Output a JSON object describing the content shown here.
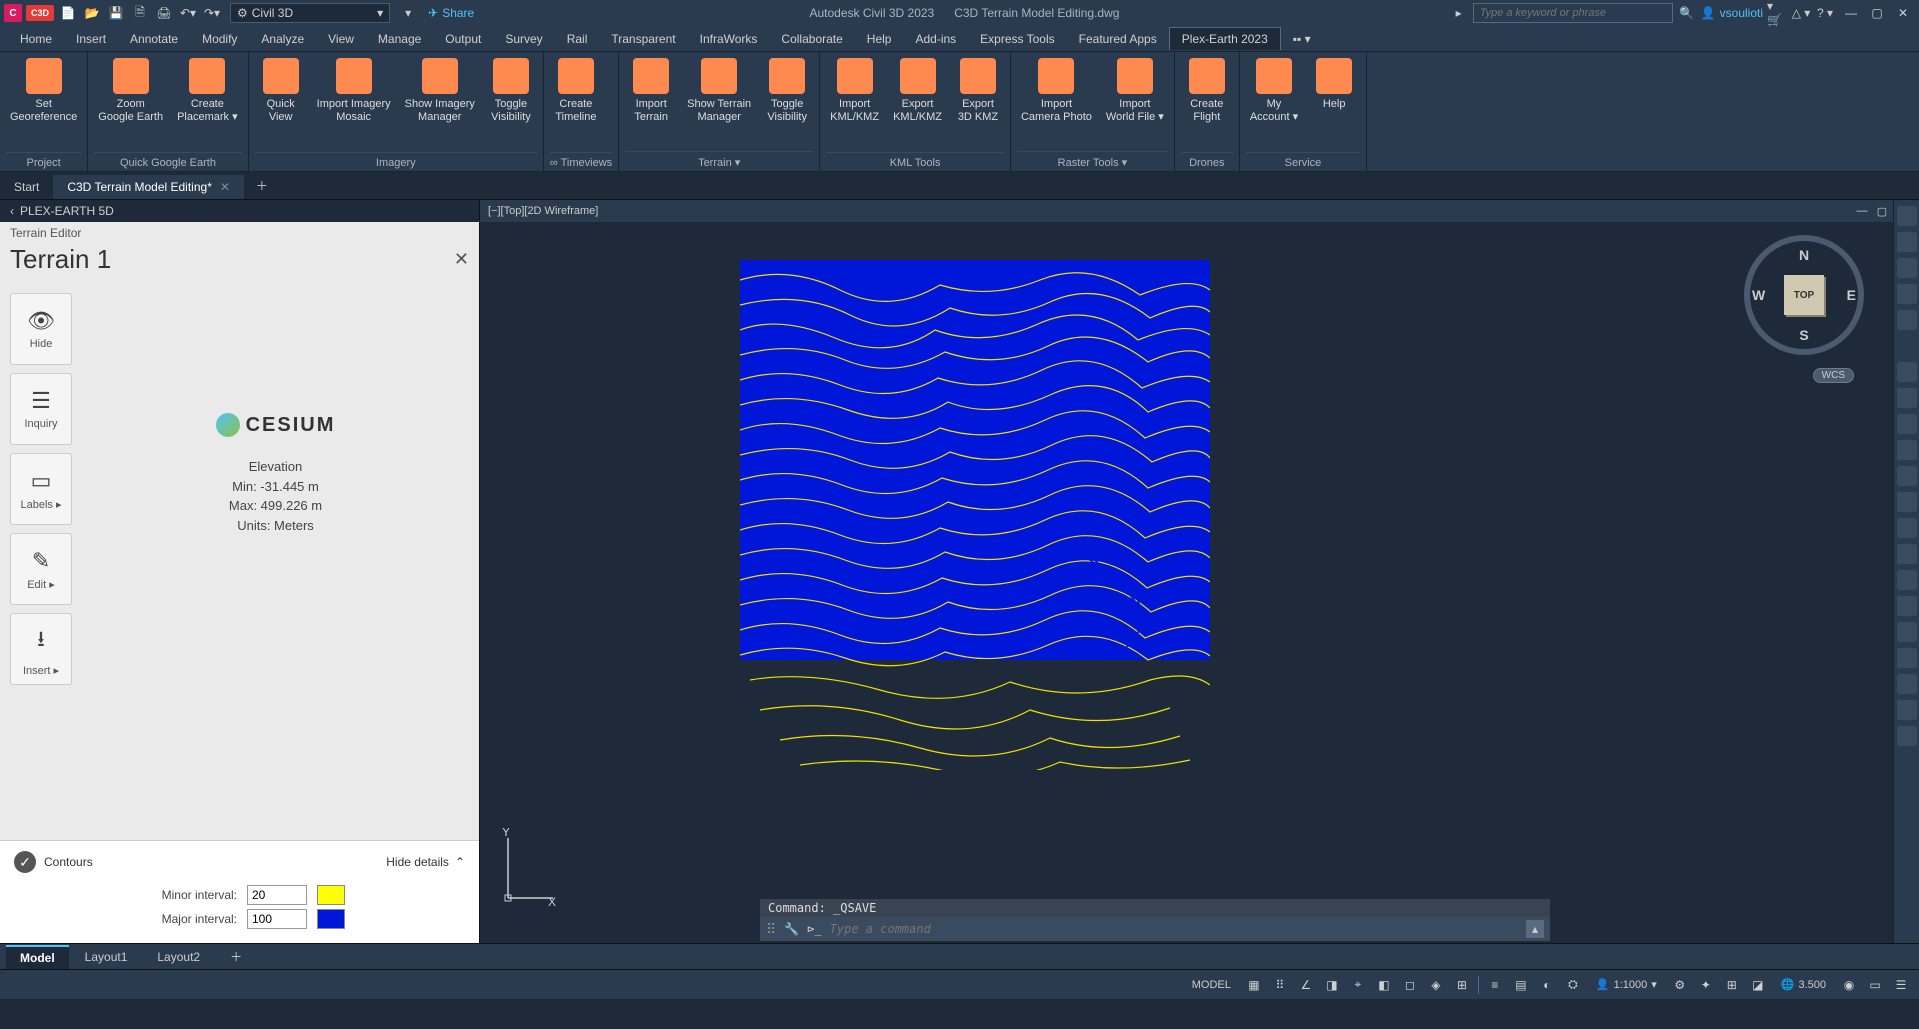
{
  "title": {
    "app": "Autodesk Civil 3D 2023",
    "file": "C3D Terrain Model Editing.dwg"
  },
  "qat": {
    "workspace": "Civil 3D",
    "share": "Share"
  },
  "search": {
    "placeholder": "Type a keyword or phrase"
  },
  "user": {
    "name": "vsoulioti"
  },
  "menu": [
    "Home",
    "Insert",
    "Annotate",
    "Modify",
    "Analyze",
    "View",
    "Manage",
    "Output",
    "Survey",
    "Rail",
    "Transparent",
    "InfraWorks",
    "Collaborate",
    "Help",
    "Add-ins",
    "Express Tools",
    "Featured Apps",
    "Plex-Earth 2023"
  ],
  "menu_active": 17,
  "ribbon": [
    {
      "title": "Project",
      "buttons": [
        {
          "label": "Set\nGeoreference"
        }
      ]
    },
    {
      "title": "Quick Google Earth",
      "buttons": [
        {
          "label": "Zoom\nGoogle Earth"
        },
        {
          "label": "Create\nPlacemark",
          "dd": true
        }
      ]
    },
    {
      "title": "Imagery",
      "buttons": [
        {
          "label": "Quick\nView"
        },
        {
          "label": "Import Imagery\nMosaic"
        },
        {
          "label": "Show Imagery\nManager"
        },
        {
          "label": "Toggle\nVisibility"
        }
      ]
    },
    {
      "title": "∞ Timeviews",
      "buttons": [
        {
          "label": "Create\nTimeline"
        }
      ]
    },
    {
      "title": "Terrain",
      "dd": true,
      "buttons": [
        {
          "label": "Import\nTerrain"
        },
        {
          "label": "Show Terrain\nManager"
        },
        {
          "label": "Toggle\nVisibility"
        }
      ]
    },
    {
      "title": "KML Tools",
      "buttons": [
        {
          "label": "Import\nKML/KMZ"
        },
        {
          "label": "Export\nKML/KMZ"
        },
        {
          "label": "Export\n3D KMZ"
        }
      ]
    },
    {
      "title": "Raster Tools",
      "dd": true,
      "buttons": [
        {
          "label": "Import\nCamera Photo"
        },
        {
          "label": "Import\nWorld File",
          "dd": true
        }
      ]
    },
    {
      "title": "Drones",
      "buttons": [
        {
          "label": "Create\nFlight"
        }
      ]
    },
    {
      "title": "Service",
      "buttons": [
        {
          "label": "My\nAccount",
          "dd": true
        },
        {
          "label": "Help"
        }
      ]
    }
  ],
  "docTabs": [
    {
      "label": "Start",
      "closable": false
    },
    {
      "label": "C3D Terrain Model Editing*",
      "closable": true,
      "active": true
    }
  ],
  "sidebar": {
    "header": "PLEX-EARTH 5D"
  },
  "terrainEditor": {
    "title": "Terrain Editor",
    "name": "Terrain 1",
    "tools": [
      {
        "label": "Hide",
        "icon": "👁"
      },
      {
        "label": "Inquiry",
        "icon": "☰"
      },
      {
        "label": "Labels",
        "icon": "▭",
        "dd": true
      },
      {
        "label": "Edit",
        "icon": "✎",
        "dd": true
      },
      {
        "label": "Insert",
        "icon": "⭳",
        "dd": true
      }
    ],
    "provider": "CESIUM",
    "elev": {
      "heading": "Elevation",
      "min": "Min: -31.445 m",
      "max": "Max: 499.226 m",
      "units": "Units: Meters"
    },
    "contours": {
      "label": "Contours",
      "hide": "Hide details",
      "minorLabel": "Minor interval:",
      "minorVal": "20",
      "minorColor": "#ffff00",
      "majorLabel": "Major interval:",
      "majorVal": "100",
      "majorColor": "#0016d9"
    }
  },
  "viewport": {
    "label": "[−][Top][2D Wireframe]",
    "cubeFace": "TOP",
    "wcs": "WCS",
    "dirs": {
      "n": "N",
      "s": "S",
      "e": "E",
      "w": "W"
    }
  },
  "cmd": {
    "history": "Command: _QSAVE",
    "prompt": "⊳_",
    "placeholder": "Type a command"
  },
  "layoutTabs": [
    "Model",
    "Layout1",
    "Layout2"
  ],
  "layoutActive": 0,
  "status": {
    "model": "MODEL",
    "scale": "1:1000",
    "decimal": "3.500",
    "zoom": ""
  }
}
